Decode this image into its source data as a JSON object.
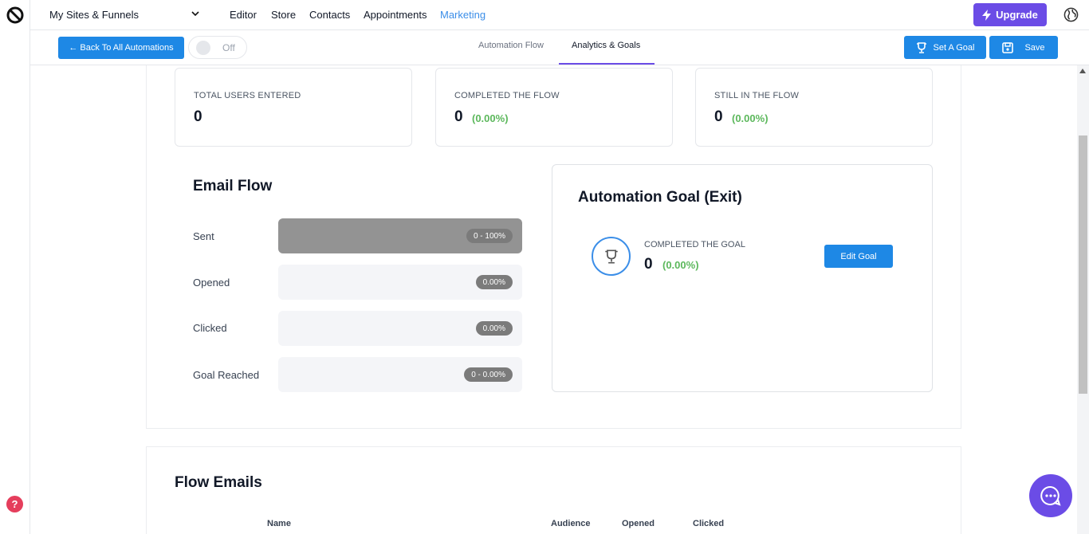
{
  "topnav": {
    "site_select": "My Sites & Funnels",
    "links": [
      "Editor",
      "Store",
      "Contacts",
      "Appointments",
      "Marketing"
    ],
    "active_link": "Marketing",
    "upgrade_label": "Upgrade"
  },
  "subbar": {
    "back_label": "← Back To All Automations",
    "toggle_label": "Off",
    "tabs": [
      "Automation Flow",
      "Analytics & Goals"
    ],
    "active_tab": "Analytics & Goals",
    "set_goal_label": "Set A Goal",
    "save_label": "Save"
  },
  "stats": [
    {
      "label": "TOTAL USERS ENTERED",
      "value": "0",
      "pct": ""
    },
    {
      "label": "COMPLETED THE FLOW",
      "value": "0",
      "pct": "(0.00%)"
    },
    {
      "label": "STILL IN THE FLOW",
      "value": "0",
      "pct": "(0.00%)"
    }
  ],
  "email_flow": {
    "title": "Email Flow",
    "rows": [
      {
        "label": "Sent",
        "badge": "0 - 100%",
        "fill": 1.0
      },
      {
        "label": "Opened",
        "badge": "0.00%",
        "fill": 0
      },
      {
        "label": "Clicked",
        "badge": "0.00%",
        "fill": 0
      },
      {
        "label": "Goal Reached",
        "badge": "0 - 0.00%",
        "fill": 0
      }
    ]
  },
  "goal": {
    "title": "Automation Goal (Exit)",
    "label": "COMPLETED THE GOAL",
    "value": "0",
    "pct": "(0.00%)",
    "edit_label": "Edit Goal"
  },
  "flow_emails": {
    "title": "Flow Emails",
    "columns": [
      "Name",
      "Audience",
      "Opened",
      "Clicked"
    ]
  },
  "colors": {
    "primary": "#1e88e5",
    "accent": "#6b4ce6",
    "success": "#5cb85c",
    "help": "#e53e5c"
  }
}
